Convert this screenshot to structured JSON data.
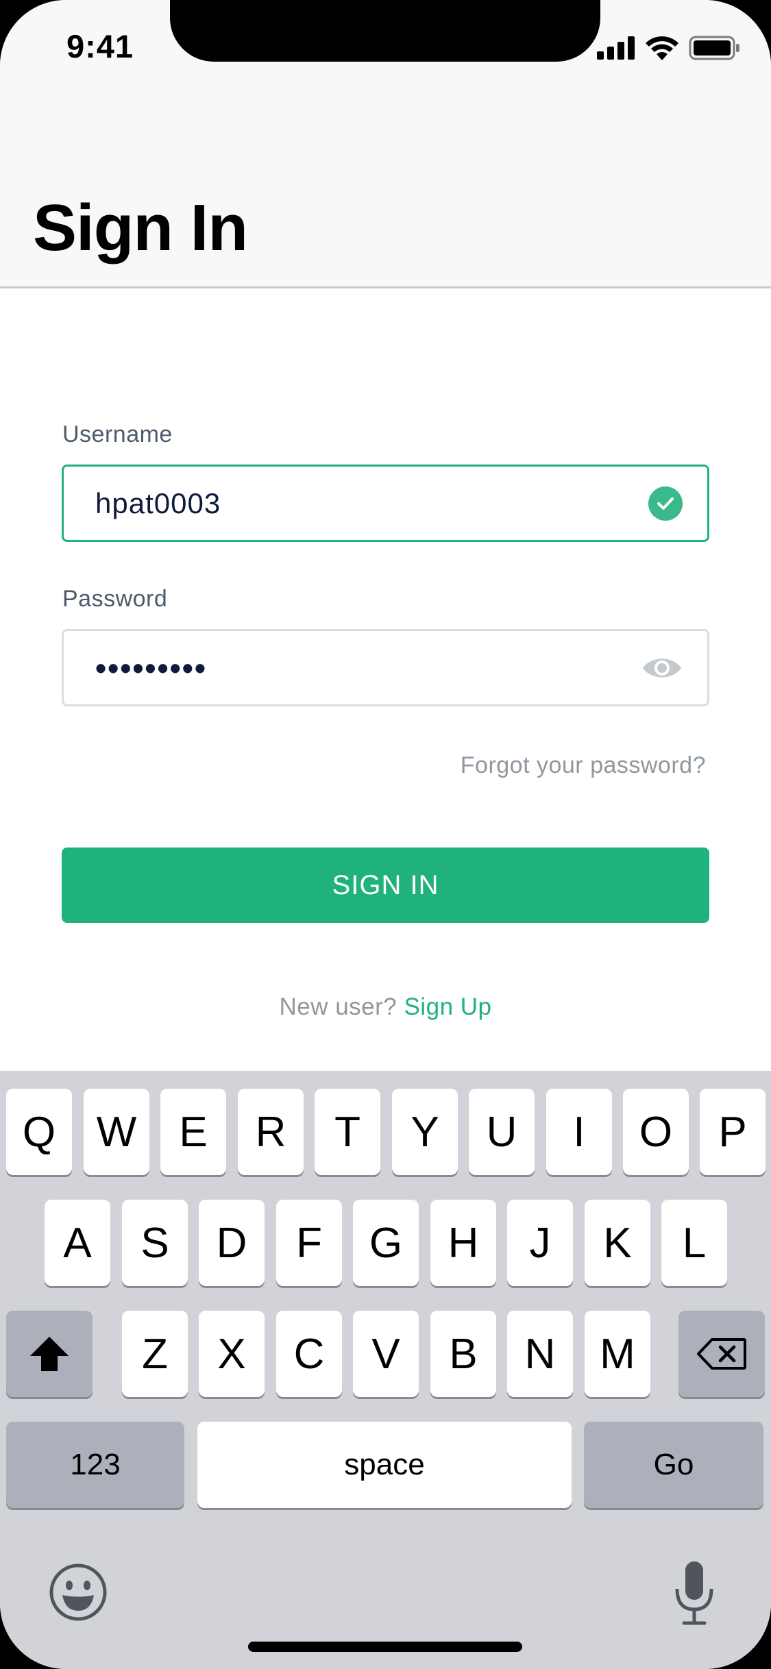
{
  "status_bar": {
    "time": "9:41"
  },
  "header": {
    "title": "Sign In"
  },
  "form": {
    "username_label": "Username",
    "username_value": "hpat0003",
    "password_label": "Password",
    "password_value": "•••••••••",
    "forgot_link": "Forgot your password?",
    "submit_label": "SIGN IN",
    "signup_prompt": "New user?",
    "signup_link": "Sign Up"
  },
  "keyboard": {
    "row1": [
      "Q",
      "W",
      "E",
      "R",
      "T",
      "Y",
      "U",
      "I",
      "O",
      "P"
    ],
    "row2": [
      "A",
      "S",
      "D",
      "F",
      "G",
      "H",
      "J",
      "K",
      "L"
    ],
    "row3": [
      "Z",
      "X",
      "C",
      "V",
      "B",
      "N",
      "M"
    ],
    "numbers_key": "123",
    "space_key": "space",
    "go_key": "Go"
  },
  "colors": {
    "accent": "#20b27b",
    "label": "#4d5a6b",
    "muted": "#8f979f",
    "keyboard_bg": "#d1d3d9"
  },
  "icons": [
    "signal-icon",
    "wifi-icon",
    "battery-icon",
    "check-icon",
    "eye-icon",
    "shift-icon",
    "backspace-icon",
    "emoji-icon",
    "microphone-icon"
  ]
}
